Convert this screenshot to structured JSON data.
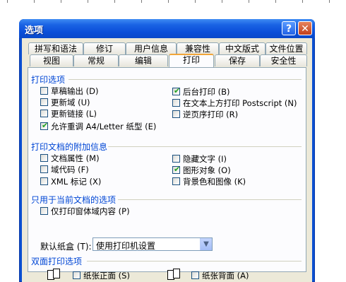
{
  "window": {
    "title": "选项",
    "help_label": "?",
    "close_label": "✕"
  },
  "tabs_row1": [
    {
      "label": "拼写和语法"
    },
    {
      "label": "修订"
    },
    {
      "label": "用户信息"
    },
    {
      "label": "兼容性"
    },
    {
      "label": "中文版式"
    },
    {
      "label": "文件位置"
    }
  ],
  "tabs_row2": [
    {
      "label": "视图"
    },
    {
      "label": "常规"
    },
    {
      "label": "编辑"
    },
    {
      "label": "打印",
      "active": true
    },
    {
      "label": "保存"
    },
    {
      "label": "安全性"
    }
  ],
  "print_options": {
    "heading": "打印选项",
    "items": [
      {
        "label": "草稿输出 (D)",
        "checked": false
      },
      {
        "label": "更新域 (U)",
        "checked": false
      },
      {
        "label": "更新链接 (L)",
        "checked": false
      },
      {
        "label": "允许重调 A4/Letter 纸型 (E)",
        "checked": true
      },
      {
        "label": "后台打印 (B)",
        "checked": true
      },
      {
        "label": "在文本上方打印 Postscript (N)",
        "checked": false
      },
      {
        "label": "逆页序打印 (R)",
        "checked": false
      }
    ]
  },
  "doc_info": {
    "heading": "打印文档的附加信息",
    "items": [
      {
        "label": "文档属性 (M)",
        "checked": false
      },
      {
        "label": "域代码 (F)",
        "checked": false
      },
      {
        "label": "XML 标记 (X)",
        "checked": false
      },
      {
        "label": "隐藏文字 (I)",
        "checked": false
      },
      {
        "label": "图形对象 (O)",
        "checked": true
      },
      {
        "label": "背景色和图像 (K)",
        "checked": false
      }
    ]
  },
  "current_doc": {
    "heading": "只用于当前文档的选项",
    "items": [
      {
        "label": "仅打印窗体域内容 (P)",
        "checked": false
      }
    ]
  },
  "tray": {
    "label": "默认纸盒 (T):",
    "value": "使用打印机设置"
  },
  "duplex": {
    "heading": "双面打印选项",
    "front_label": "纸张正面 (S)",
    "back_label": "纸张背面 (A)"
  },
  "colors": {
    "title_bar": "#0a4ed8",
    "dialog_face": "#ece9d8",
    "group_heading": "#0046d5",
    "active_tab_accent": "#f1a539",
    "check_mark": "#21a121"
  }
}
